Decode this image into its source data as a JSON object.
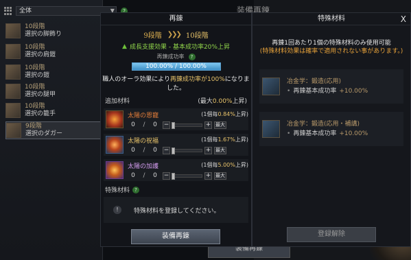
{
  "background": {
    "filter_value": "全体",
    "page_title": "装備再錬",
    "bottom_button": "装備再錬",
    "items": [
      {
        "stage": "10段階",
        "name": "選択の脚飾り"
      },
      {
        "stage": "10段階",
        "name": "選択の肩鎧"
      },
      {
        "stage": "10段階",
        "name": "選択の鎧"
      },
      {
        "stage": "10段階",
        "name": "選択の腿甲"
      },
      {
        "stage": "10段階",
        "name": "選択の籠手"
      },
      {
        "stage": "9段階",
        "name": "選択のダガー"
      }
    ]
  },
  "main": {
    "title": "再錬",
    "from_stage": "9段階",
    "to_stage": "10段階",
    "support_text": "成長支援効果 - 基本成功率20%上昇",
    "rate_label": "再錬成功率",
    "rate_value": "100.00% / 100.00%",
    "note_prefix": "職人のオーラ効果により",
    "note_highlight": "再錬成功率が100%",
    "note_suffix": "になりました。",
    "add_label": "追加材料",
    "max_prefix": "(最大",
    "max_value": "0.00%",
    "max_suffix": "上昇)",
    "materials": [
      {
        "name": "太陽の恩寵",
        "per_prefix": "(1個毎",
        "per_value": "0.84%",
        "per_suffix": "上昇)",
        "qty": "0",
        "slash": "/",
        "owned": "0",
        "minus": "−",
        "plus": "+",
        "max_btn": "最大"
      },
      {
        "name": "太陽の祝福",
        "per_prefix": "(1個毎",
        "per_value": "1.67%",
        "per_suffix": "上昇)",
        "qty": "0",
        "slash": "/",
        "owned": "0",
        "minus": "−",
        "plus": "+",
        "max_btn": "最大"
      },
      {
        "name": "太陽の加護",
        "per_prefix": "(1個毎",
        "per_value": "5.00%",
        "per_suffix": "上昇)",
        "qty": "0",
        "slash": "/",
        "owned": "0",
        "minus": "−",
        "plus": "+",
        "max_btn": "最大"
      }
    ],
    "special_label": "特殊材料",
    "special_placeholder": "特殊材料を登録してください。",
    "refine_button": "装備再錬"
  },
  "right": {
    "title": "特殊材料",
    "close": "X",
    "note_line1": "再錬1回あたり1個の特殊材料のみ使用可能",
    "note_line2": "(特殊材料効果は確率で適用されない事があります。)",
    "items": [
      {
        "name": "冶金学：鍛造(応用)",
        "effect": "再錬基本成功率",
        "pct": "+10.00%"
      },
      {
        "name": "冶金学：鍛造(応用・補講)",
        "effect": "再錬基本成功率",
        "pct": "+10.00%"
      }
    ],
    "release_button": "登録解除"
  }
}
